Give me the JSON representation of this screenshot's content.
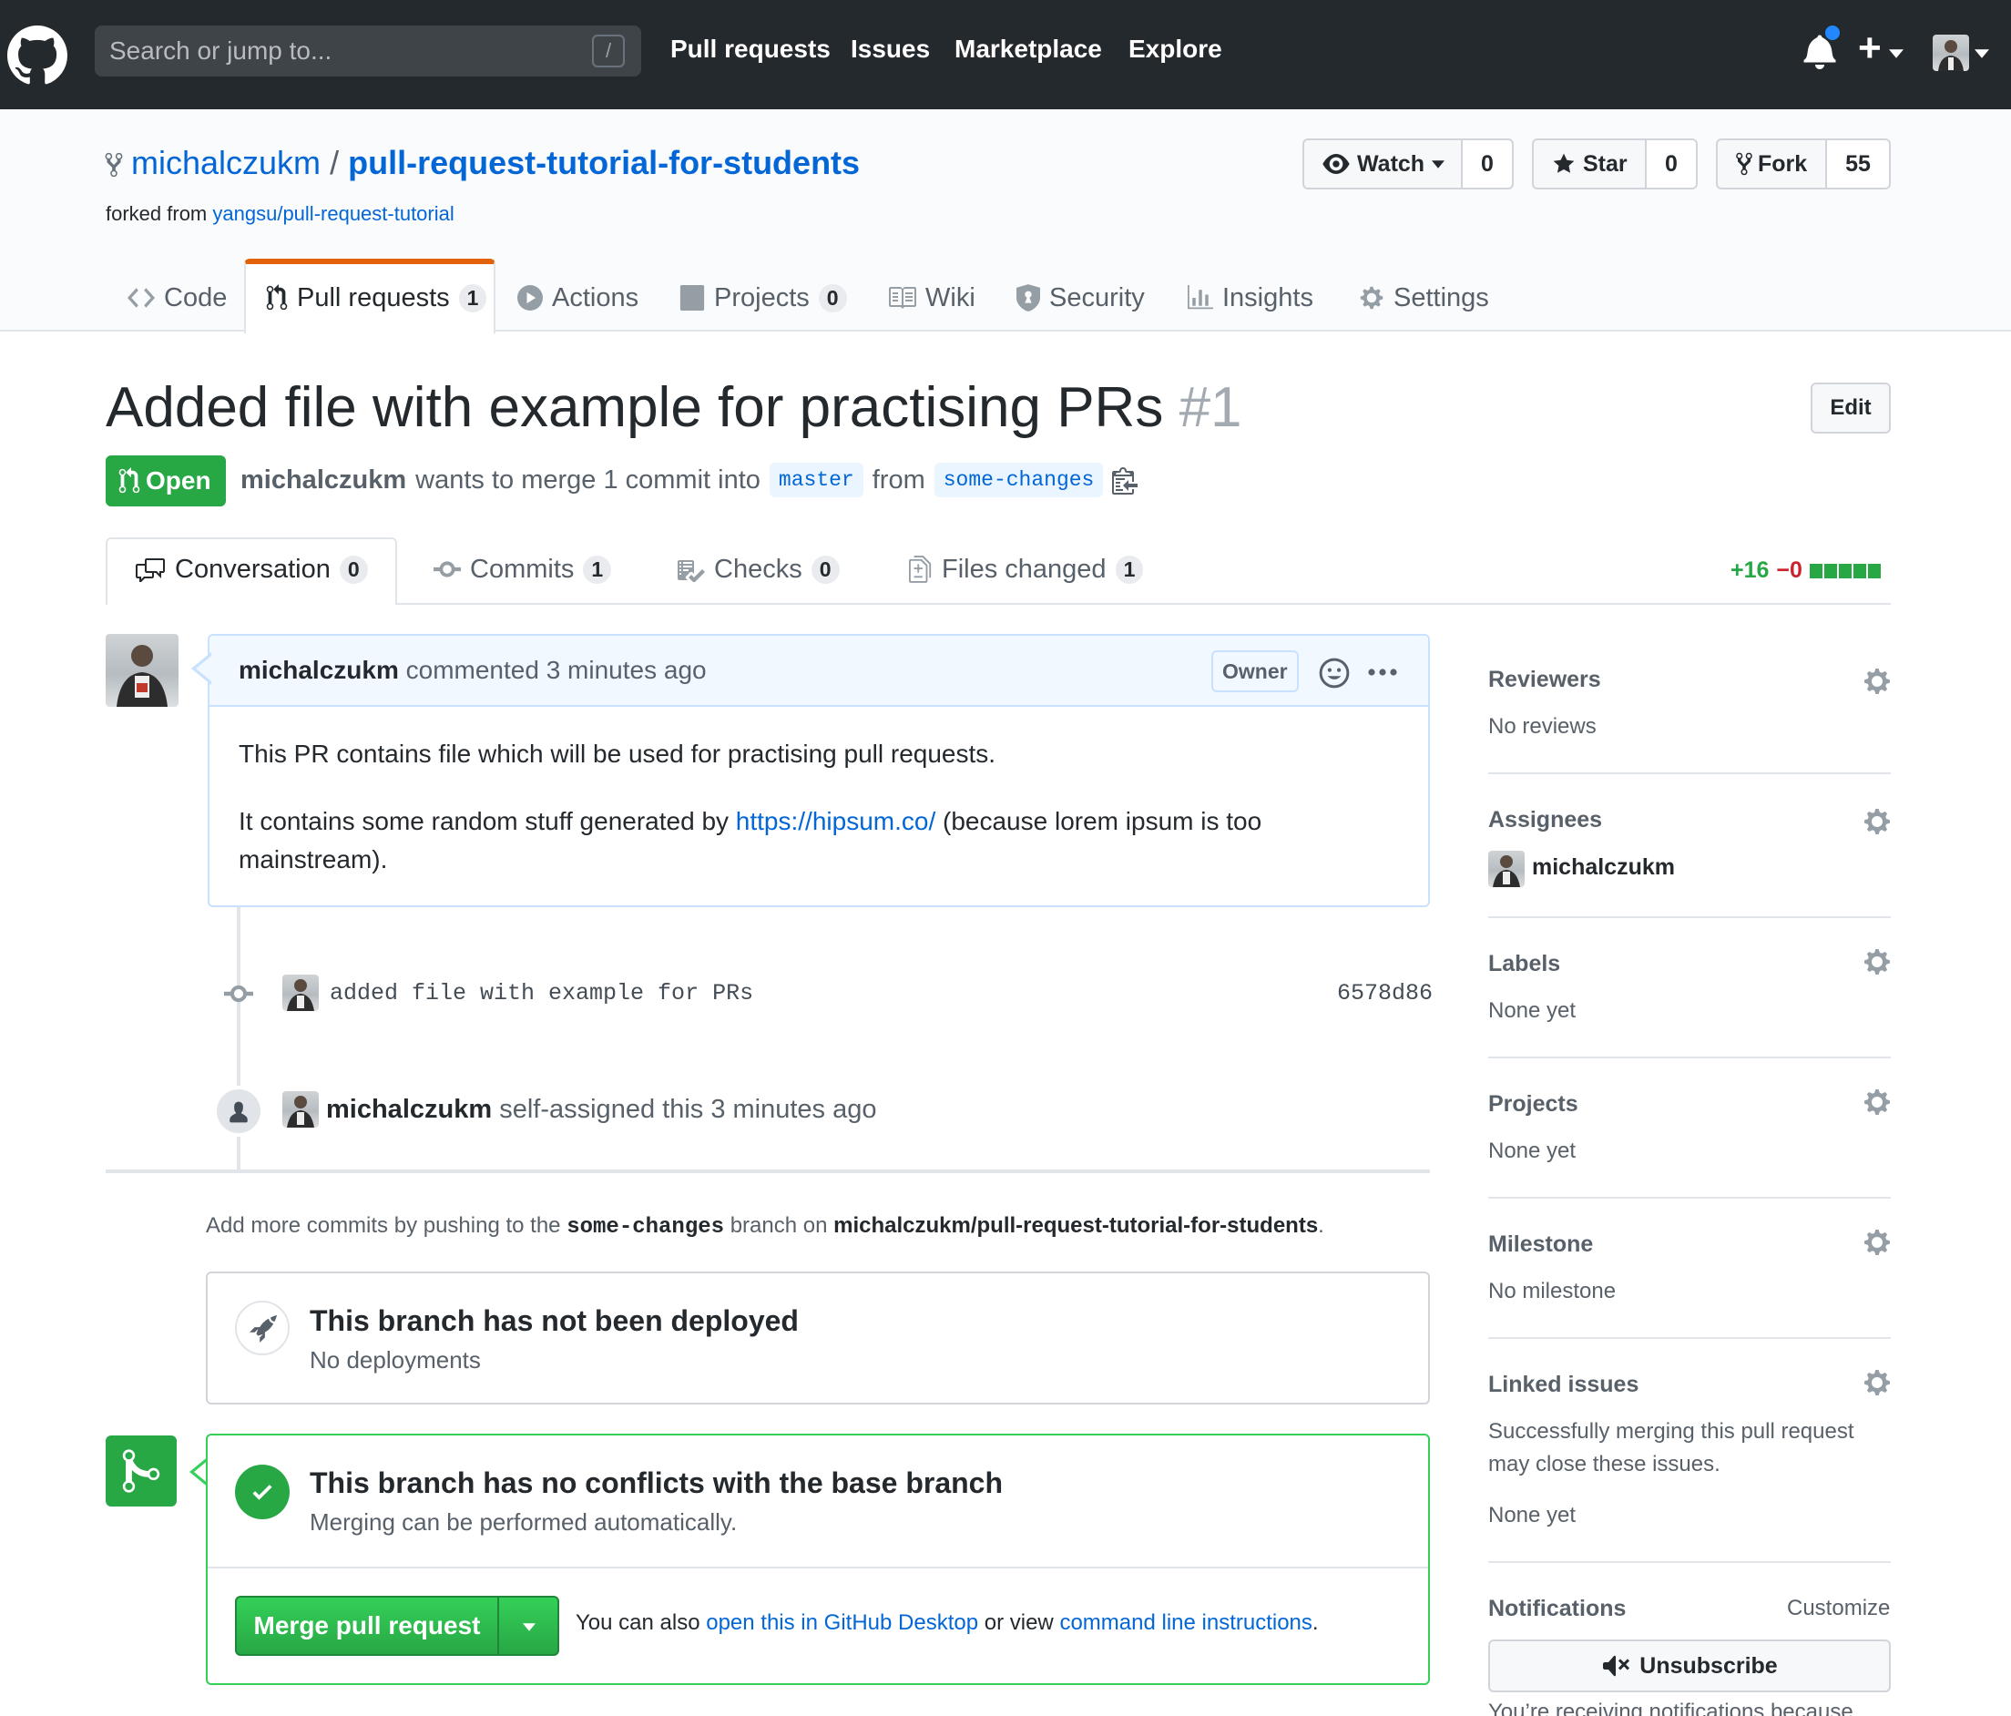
{
  "header": {
    "search_placeholder": "Search or jump to...",
    "slash_key": "/",
    "nav": [
      "Pull requests",
      "Issues",
      "Marketplace",
      "Explore"
    ],
    "plus": "+"
  },
  "repo": {
    "owner": "michalczukm",
    "separator": "/",
    "name": "pull-request-tutorial-for-students",
    "forked_from_label": "forked from",
    "forked_from": "yangsu/pull-request-tutorial",
    "watch_label": "Watch",
    "watch_count": "0",
    "star_label": "Star",
    "star_count": "0",
    "fork_label": "Fork",
    "fork_count": "55"
  },
  "repo_tabs": [
    {
      "label": "Code",
      "count": ""
    },
    {
      "label": "Pull requests",
      "count": "1"
    },
    {
      "label": "Actions",
      "count": ""
    },
    {
      "label": "Projects",
      "count": "0"
    },
    {
      "label": "Wiki",
      "count": ""
    },
    {
      "label": "Security",
      "count": ""
    },
    {
      "label": "Insights",
      "count": ""
    },
    {
      "label": "Settings",
      "count": ""
    }
  ],
  "pr": {
    "title": "Added file with example for practising PRs",
    "number": "#1",
    "edit_label": "Edit",
    "state": "Open",
    "author": "michalczukm",
    "merge_text": "wants to merge 1 commit into",
    "base_branch": "master",
    "from_text": "from",
    "head_branch": "some-changes"
  },
  "pr_tabs": [
    {
      "label": "Conversation",
      "count": "0"
    },
    {
      "label": "Commits",
      "count": "1"
    },
    {
      "label": "Checks",
      "count": "0"
    },
    {
      "label": "Files changed",
      "count": "1"
    }
  ],
  "diffstat": {
    "additions": "+16",
    "deletions": "−0"
  },
  "comment": {
    "author": "michalczukm",
    "action": "commented 3 minutes ago",
    "badge": "Owner",
    "body_line1": "This PR contains file which will be used for practising pull requests.",
    "body_pre": "It contains some random stuff generated by",
    "body_link": "https://hipsum.co/",
    "body_post": "(because lorem ipsum is too",
    "body_post2": "mainstream)."
  },
  "commit": {
    "message": "added file with example for PRs",
    "sha": "6578d86"
  },
  "event": {
    "actor": "michalczukm",
    "text": "self-assigned this 3 minutes ago"
  },
  "push_note": {
    "pre": "Add more commits by pushing to the",
    "branch": "some-changes",
    "mid": "branch on",
    "repo": "michalczukm/pull-request-tutorial-for-students",
    "end": "."
  },
  "deploy": {
    "title": "This branch has not been deployed",
    "sub": "No deployments"
  },
  "merge": {
    "title": "This branch has no conflicts with the base branch",
    "sub": "Merging can be performed automatically.",
    "button": "Merge pull request",
    "also_pre": "You can also",
    "desktop_link": "open this in GitHub Desktop",
    "or_view": "or view",
    "cli_link": "command line instructions",
    "end": "."
  },
  "sidebar": {
    "reviewers": {
      "title": "Reviewers",
      "value": "No reviews"
    },
    "assignees": {
      "title": "Assignees",
      "value": "michalczukm"
    },
    "labels": {
      "title": "Labels",
      "value": "None yet"
    },
    "projects": {
      "title": "Projects",
      "value": "None yet"
    },
    "milestone": {
      "title": "Milestone",
      "value": "No milestone"
    },
    "linked": {
      "title": "Linked issues",
      "desc1": "Successfully merging this pull request",
      "desc2": "may close these issues.",
      "value": "None yet"
    },
    "notifications": {
      "title": "Notifications",
      "customize": "Customize",
      "unsubscribe": "Unsubscribe",
      "footer": "You’re receiving notifications because"
    }
  },
  "colors": {
    "header_bg": "#24292e",
    "green": "#28a745",
    "link": "#0366d6",
    "red": "#cb2431"
  }
}
